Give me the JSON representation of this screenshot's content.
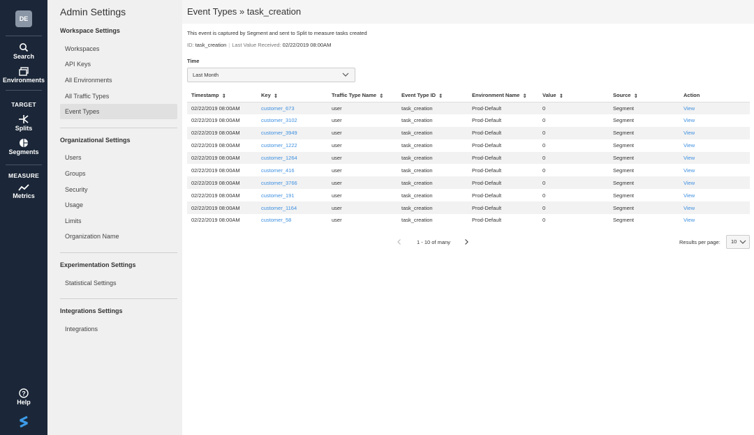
{
  "rail": {
    "avatar": "DE",
    "items": [
      {
        "label": "Search",
        "icon": "search-icon"
      },
      {
        "label": "Environments",
        "icon": "environments-icon"
      },
      {
        "label": "Splits",
        "icon": "splits-icon"
      },
      {
        "label": "Segments",
        "icon": "segments-icon"
      },
      {
        "label": "Metrics",
        "icon": "metrics-icon"
      },
      {
        "label": "Help",
        "icon": "help-icon"
      }
    ],
    "sections": {
      "target": "TARGET",
      "measure": "MEASURE"
    },
    "logo": "split-logo-icon"
  },
  "sidebar": {
    "title": "Admin Settings",
    "workspace": {
      "heading": "Workspace Settings",
      "links": [
        "Workspaces",
        "API Keys",
        "All Environments",
        "All Traffic Types",
        "Event Types"
      ]
    },
    "organizational": {
      "heading": "Organizational Settings",
      "links": [
        "Users",
        "Groups",
        "Security",
        "Usage",
        "Limits",
        "Organization Name"
      ]
    },
    "experimentation": {
      "heading": "Experimentation Settings",
      "links": [
        "Statistical Settings"
      ]
    },
    "integrations": {
      "heading": "Integrations Settings",
      "links": [
        "Integrations"
      ]
    },
    "active": "Event Types"
  },
  "main": {
    "title": "Event Types » task_creation",
    "description": "This event is captured by Segment and sent to Split to measure tasks created",
    "id_label": "ID:",
    "id_value": "task_creation",
    "last_label": "Last Value Received:",
    "last_value": "02/22/2019 08:00AM",
    "time_label": "Time",
    "time_value": "Last Month",
    "columns": [
      "Timestamp",
      "Key",
      "Traffic Type Name",
      "Event Type ID",
      "Environment Name",
      "Value",
      "Source",
      "Action"
    ],
    "rows": [
      [
        "02/22/2019 08:00AM",
        "customer_673",
        "user",
        "task_creation",
        "Prod-Default",
        "0",
        "Segment",
        "View"
      ],
      [
        "02/22/2019 08:00AM",
        "customer_3102",
        "user",
        "task_creation",
        "Prod-Default",
        "0",
        "Segment",
        "View"
      ],
      [
        "02/22/2019 08:00AM",
        "customer_3949",
        "user",
        "task_creation",
        "Prod-Default",
        "0",
        "Segment",
        "View"
      ],
      [
        "02/22/2019 08:00AM",
        "customer_1222",
        "user",
        "task_creation",
        "Prod-Default",
        "0",
        "Segment",
        "View"
      ],
      [
        "02/22/2019 08:00AM",
        "customer_1264",
        "user",
        "task_creation",
        "Prod-Default",
        "0",
        "Segment",
        "View"
      ],
      [
        "02/22/2019 08:00AM",
        "customer_416",
        "user",
        "task_creation",
        "Prod-Default",
        "0",
        "Segment",
        "View"
      ],
      [
        "02/22/2019 08:00AM",
        "customer_3766",
        "user",
        "task_creation",
        "Prod-Default",
        "0",
        "Segment",
        "View"
      ],
      [
        "02/22/2019 08:00AM",
        "customer_191",
        "user",
        "task_creation",
        "Prod-Default",
        "0",
        "Segment",
        "View"
      ],
      [
        "02/22/2019 08:00AM",
        "customer_1164",
        "user",
        "task_creation",
        "Prod-Default",
        "0",
        "Segment",
        "View"
      ],
      [
        "02/22/2019 08:00AM",
        "customer_58",
        "user",
        "task_creation",
        "Prod-Default",
        "0",
        "Segment",
        "View"
      ]
    ],
    "pagination": "1 - 10 of many",
    "rpp_label": "Results per page:",
    "rpp_value": "10"
  },
  "colors": {
    "rail_bg": "#1b2738",
    "link": "#3d8fe0",
    "sidebar_bg": "#f0f0f0"
  }
}
